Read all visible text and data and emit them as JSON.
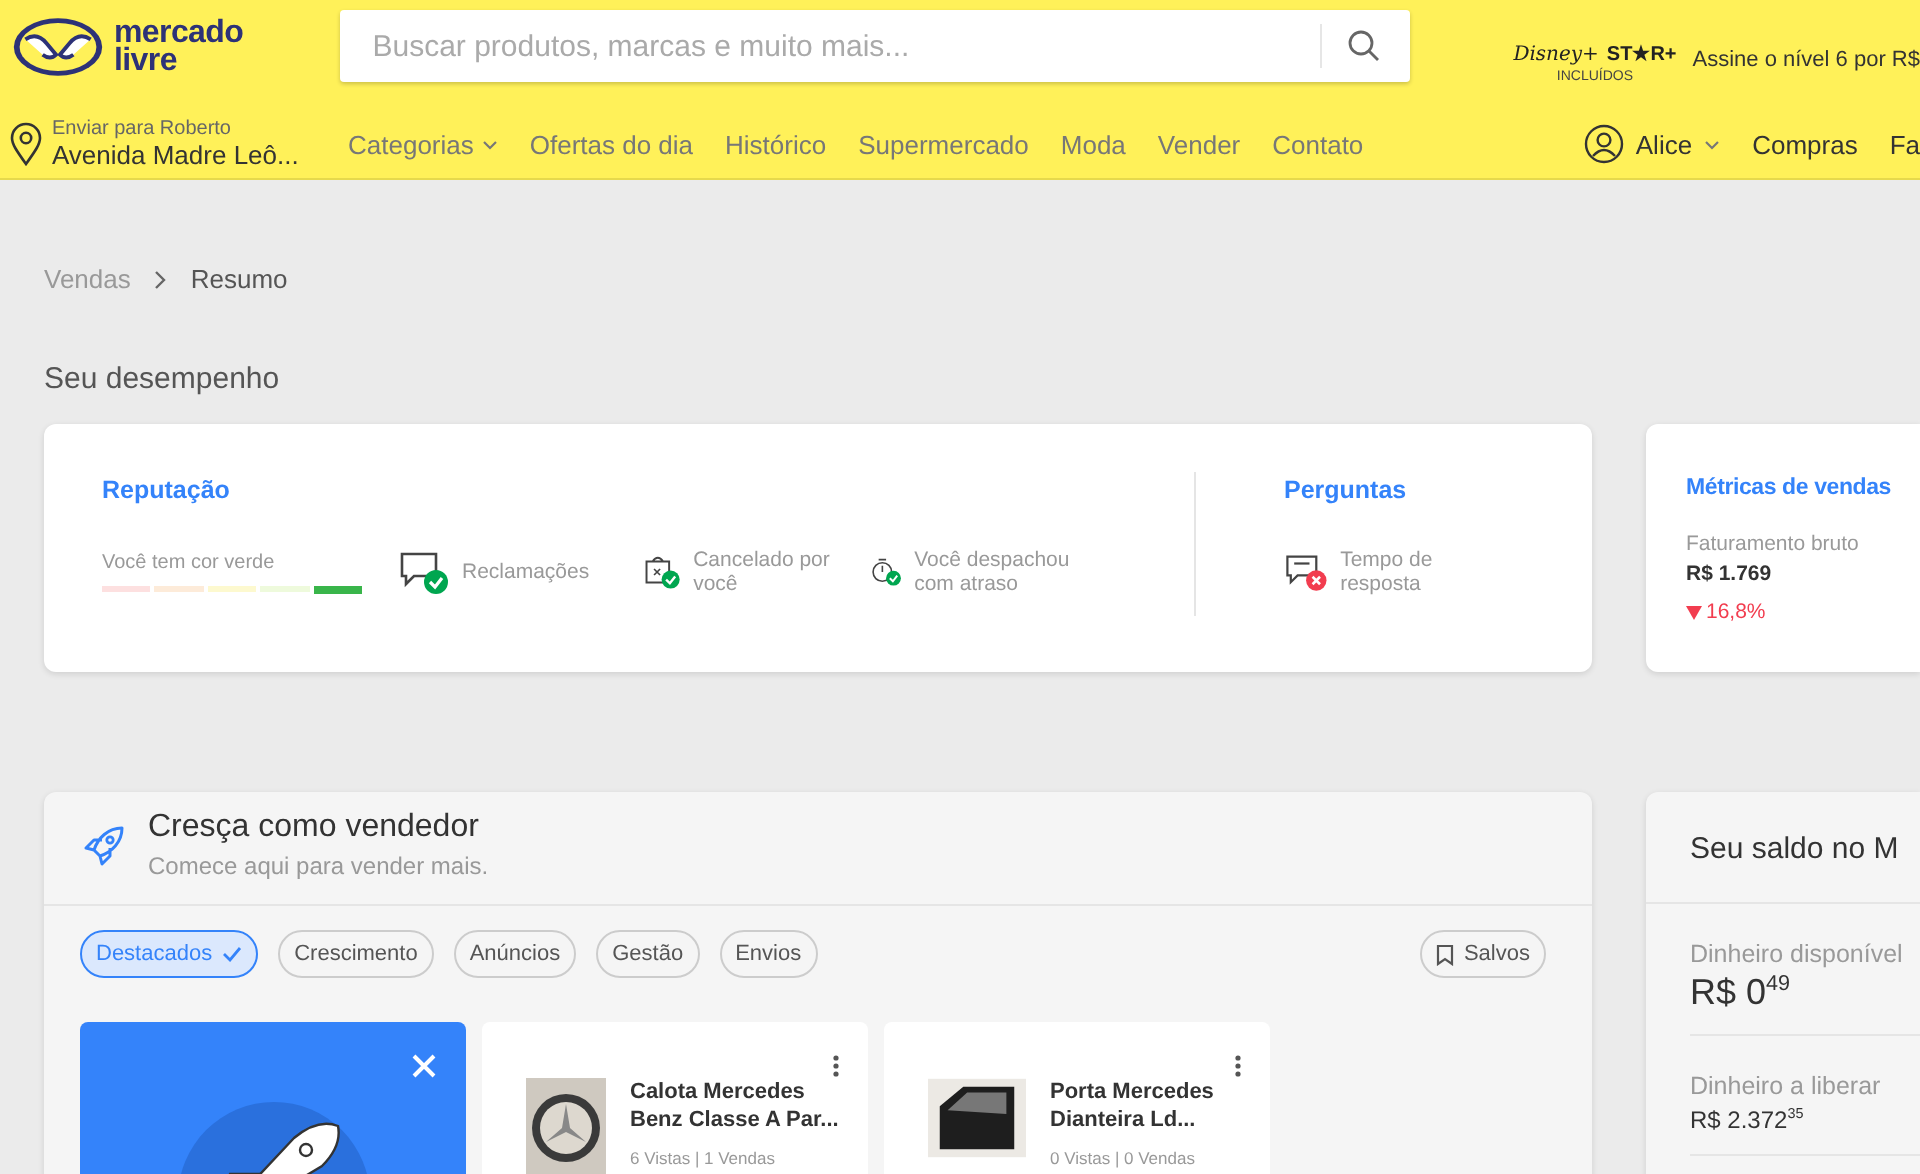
{
  "header": {
    "logo": {
      "line1": "mercado",
      "line2": "livre"
    },
    "search": {
      "placeholder": "Buscar produtos, marcas e muito mais..."
    },
    "promo": {
      "brand1": "Disney+",
      "brand2": "ST★R+",
      "included": "INCLUÍDOS",
      "text": "Assine o nível 6 por R$"
    },
    "location": {
      "label": "Enviar para Roberto",
      "address": "Avenida Madre Leô..."
    },
    "nav": [
      {
        "label": "Categorias",
        "dropdown": true
      },
      {
        "label": "Ofertas do dia",
        "dropdown": false
      },
      {
        "label": "Histórico",
        "dropdown": false
      },
      {
        "label": "Supermercado",
        "dropdown": false
      },
      {
        "label": "Moda",
        "dropdown": false
      },
      {
        "label": "Vender",
        "dropdown": false
      },
      {
        "label": "Contato",
        "dropdown": false
      }
    ],
    "user": {
      "name": "Alice",
      "links": [
        "Compras",
        "Fa"
      ]
    }
  },
  "breadcrumb": [
    "Vendas",
    "Resumo"
  ],
  "performance": {
    "title": "Seu desempenho",
    "reputation": {
      "title": "Reputação",
      "caption": "Você tem cor verde",
      "thermometer": [
        {
          "color": "#fde0e0",
          "selected": false
        },
        {
          "color": "#fdebd9",
          "selected": false
        },
        {
          "color": "#fdf9cf",
          "selected": false
        },
        {
          "color": "#eefadc",
          "selected": false
        },
        {
          "color": "#39b54a",
          "selected": true
        }
      ],
      "items": [
        {
          "kind": "chat",
          "passed": true,
          "label": "Reclamações"
        },
        {
          "kind": "bag",
          "passed": true,
          "label": "Cancelado por você"
        },
        {
          "kind": "timer",
          "passed": true,
          "label": "Você despachou com atraso"
        }
      ]
    },
    "questions": {
      "title": "Perguntas",
      "items": [
        {
          "kind": "chat",
          "passed": false,
          "label": "Tempo de resposta"
        }
      ]
    },
    "metrics": {
      "title": "Métricas de vendas",
      "label": "Faturamento bruto",
      "value": "R$ 1.769",
      "change": "16,8%",
      "decline": true
    }
  },
  "grow": {
    "title": "Cresça como vendedor",
    "subtitle": "Comece aqui para vender mais.",
    "chips": [
      {
        "label": "Destacados",
        "selected": true
      },
      {
        "label": "Crescimento",
        "selected": false
      },
      {
        "label": "Anúncios",
        "selected": false
      },
      {
        "label": "Gestão",
        "selected": false
      },
      {
        "label": "Envios",
        "selected": false
      }
    ],
    "saved": "Salvos",
    "products": [
      {
        "kind": "hubcap",
        "title": "Calota Mercedes Benz Classe A Par...",
        "stats": "6 Vistas | 1 Vendas"
      },
      {
        "kind": "door",
        "title": "Porta Mercedes Dianteira Ld...",
        "stats": "0 Vistas | 0 Vendas"
      }
    ]
  },
  "balance": {
    "title": "Seu saldo no M",
    "rows": [
      {
        "label": "Dinheiro disponível",
        "value": "R$ 0$^{49}$",
        "highlighted": true
      },
      {
        "label": "Dinheiro a liberar",
        "value": "R$ 2.372$^{35}$",
        "highlighted": false
      }
    ]
  }
}
